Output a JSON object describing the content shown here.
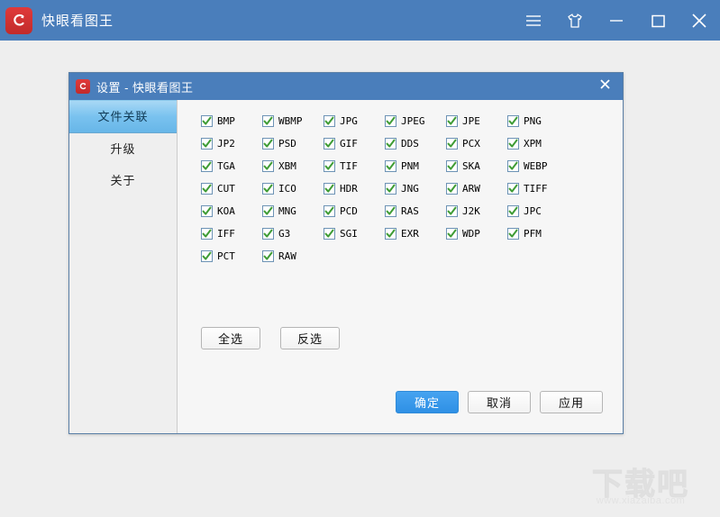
{
  "window": {
    "app_title": "快眼看图王",
    "icon": "app-logo-icon",
    "titlebar_color": "#4a7ebb",
    "buttons": [
      {
        "name": "menu-button",
        "icon": "hamburger-menu-icon"
      },
      {
        "name": "skin-button",
        "icon": "tshirt-icon"
      },
      {
        "name": "minimize-button",
        "icon": "minimize-icon"
      },
      {
        "name": "maximize-button",
        "icon": "maximize-icon"
      },
      {
        "name": "close-button",
        "icon": "close-icon"
      }
    ]
  },
  "dialog": {
    "title": "设置 - 快眼看图王",
    "icon": "app-logo-icon",
    "close_icon": "close-icon",
    "sidebar": {
      "items": [
        {
          "label": "文件关联",
          "active": true
        },
        {
          "label": "升级",
          "active": false
        },
        {
          "label": "关于",
          "active": false
        }
      ]
    },
    "formats": {
      "rows": [
        [
          "BMP",
          "WBMP",
          "JPG",
          "JPEG",
          "JPE",
          "PNG"
        ],
        [
          "JP2",
          "PSD",
          "GIF",
          "DDS",
          "PCX",
          "XPM"
        ],
        [
          "TGA",
          "XBM",
          "TIF",
          "PNM",
          "SKA",
          "WEBP"
        ],
        [
          "CUT",
          "ICO",
          "HDR",
          "JNG",
          "ARW",
          "TIFF"
        ],
        [
          "KOA",
          "MNG",
          "PCD",
          "RAS",
          "J2K",
          "JPC"
        ],
        [
          "IFF",
          "G3",
          "SGI",
          "EXR",
          "WDP",
          "PFM"
        ],
        [
          "PCT",
          "RAW",
          "",
          "",
          "",
          ""
        ]
      ],
      "all_checked": true,
      "check_color": "#3f9c35",
      "box_border_color": "#6d93b5"
    },
    "select_buttons": [
      {
        "label": "全选",
        "name": "select-all-button"
      },
      {
        "label": "反选",
        "name": "invert-selection-button"
      }
    ],
    "action_buttons": [
      {
        "label": "确定",
        "name": "ok-button",
        "primary": true
      },
      {
        "label": "取消",
        "name": "cancel-button",
        "primary": false
      },
      {
        "label": "应用",
        "name": "apply-button",
        "primary": false
      }
    ]
  },
  "watermark": {
    "brand_cn": "下载吧",
    "url": "www.xiazaiba.com"
  }
}
